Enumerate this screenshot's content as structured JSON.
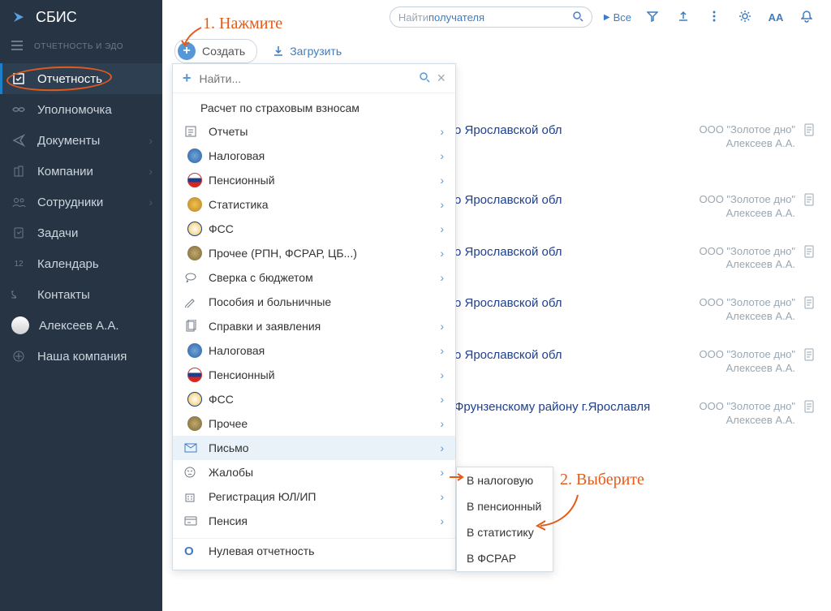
{
  "app": {
    "title": "СБИС",
    "subtitle": "ОТЧЕТНОСТЬ И ЭДО"
  },
  "sidebar": {
    "items": [
      {
        "label": "Отчетность"
      },
      {
        "label": "Уполномочка"
      },
      {
        "label": "Документы"
      },
      {
        "label": "Компании"
      },
      {
        "label": "Сотрудники"
      },
      {
        "label": "Задачи"
      },
      {
        "label": "Календарь",
        "badge": "12"
      },
      {
        "label": "Контакты"
      },
      {
        "label": "Алексеев А.А."
      },
      {
        "label": "Наша компания"
      }
    ]
  },
  "topbar": {
    "search_prefix": "Найти ",
    "search_highlight": "получателя",
    "filter_all": "Все"
  },
  "actions": {
    "create": "Создать",
    "upload": "Загрузить"
  },
  "dropdown": {
    "search_placeholder": "Найти...",
    "first_item": "Расчет по страховым взносам",
    "section_reports": "Отчеты",
    "reports": [
      {
        "label": "Налоговая"
      },
      {
        "label": "Пенсионный"
      },
      {
        "label": "Статистика"
      },
      {
        "label": "ФСС"
      },
      {
        "label": "Прочее (РПН, ФСРАР, ЦБ...)"
      }
    ],
    "rows1": [
      {
        "label": "Сверка с бюджетом"
      },
      {
        "label": "Пособия и больничные"
      }
    ],
    "section_certs": "Справки и заявления",
    "certs": [
      {
        "label": "Налоговая"
      },
      {
        "label": "Пенсионный"
      },
      {
        "label": "ФСС"
      },
      {
        "label": "Прочее"
      }
    ],
    "rows2": [
      {
        "label": "Письмо"
      },
      {
        "label": "Жалобы"
      },
      {
        "label": "Регистрация ЮЛ/ИП"
      },
      {
        "label": "Пенсия"
      }
    ],
    "zero": "Нулевая отчетность"
  },
  "submenu": {
    "items": [
      "В налоговую",
      "В пенсионный",
      "В статистику",
      "В ФСРАР"
    ]
  },
  "results": [
    {
      "title": "о Ярославской обл",
      "org": "ООО \"Золотое дно\"",
      "person": "Алексеев А.А."
    },
    {
      "title": "о Ярославской обл",
      "org": "ООО \"Золотое дно\"",
      "person": "Алексеев А.А."
    },
    {
      "title": "о Ярославской обл",
      "org": "ООО \"Золотое дно\"",
      "person": "Алексеев А.А."
    },
    {
      "title": "о Ярославской обл",
      "org": "ООО \"Золотое дно\"",
      "person": "Алексеев А.А."
    },
    {
      "title": "о Ярославской обл",
      "org": "ООО \"Золотое дно\"",
      "person": "Алексеев А.А."
    },
    {
      "title": "Фрунзенскому району г.Ярославля",
      "org": "ООО \"Золотое дно\"",
      "person": "Алексеев А.А."
    }
  ],
  "annotations": {
    "step1": "1. Нажмите",
    "step2": "2. Выберите"
  }
}
